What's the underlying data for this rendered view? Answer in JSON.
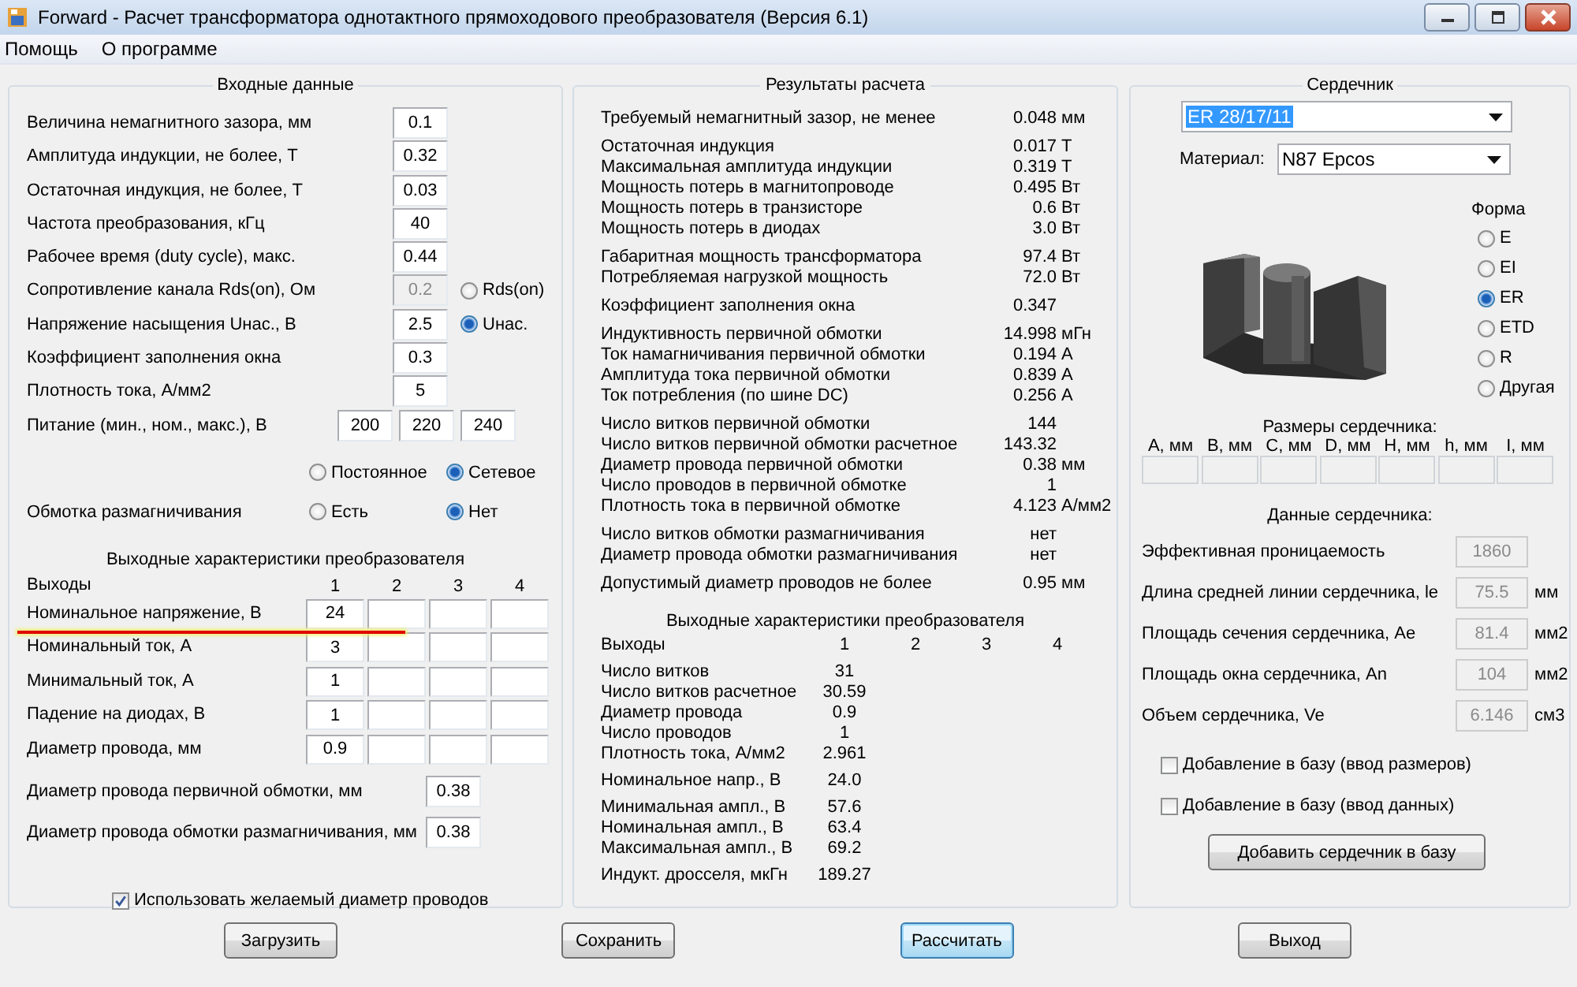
{
  "window": {
    "title": "Forward - Расчет трансформатора однотактного прямоходового преобразователя (Версия 6.1)"
  },
  "menu": [
    {
      "label": "Помощь"
    },
    {
      "label": "О программе"
    }
  ],
  "input_panel": {
    "title": "Входные данные",
    "fields": [
      {
        "label": "Величина немагнитного зазора, мм",
        "value": "0.1",
        "disabled": false
      },
      {
        "label": "Амплитуда индукции, не более, Т",
        "value": "0.32",
        "disabled": false
      },
      {
        "label": "Остаточная индукция, не более, Т",
        "value": "0.03",
        "disabled": false
      },
      {
        "label": "Частота преобразования, кГц",
        "value": "40",
        "disabled": false
      },
      {
        "label": "Рабочее время (duty cycle), макс.",
        "value": "0.44",
        "disabled": false
      },
      {
        "label": "Сопротивление канала Rds(on), Ом",
        "value": "0.2",
        "disabled": true,
        "radio": {
          "label": "Rds(on)",
          "selected": false
        }
      },
      {
        "label": "Напряжение насыщения Uнас., В",
        "value": "2.5",
        "disabled": false,
        "radio": {
          "label": "Uнас.",
          "selected": true
        }
      },
      {
        "label": "Коэффициент заполнения окна",
        "value": "0.3",
        "disabled": false
      },
      {
        "label": "Плотность тока, А/мм2",
        "value": "5",
        "disabled": false
      }
    ],
    "supply": {
      "label": "Питание (мин., ном., макс.), В",
      "values": [
        "200",
        "220",
        "240"
      ]
    },
    "source_options": [
      {
        "label": "Постоянное",
        "selected": false
      },
      {
        "label": "Сетевое",
        "selected": true
      }
    ],
    "demag": {
      "label": "Обмотка размагничивания",
      "options": [
        {
          "label": "Есть",
          "selected": false
        },
        {
          "label": "Нет",
          "selected": true
        }
      ]
    },
    "outputs": {
      "title": "Выходные характеристики преобразователя",
      "header": [
        "Выходы",
        "1",
        "2",
        "3",
        "4"
      ],
      "rows": [
        {
          "label": "Номинальное напряжение, В",
          "values": [
            "24"
          ]
        },
        {
          "label": "Номинальный ток, А",
          "values": [
            "3"
          ]
        },
        {
          "label": "Минимальный ток, А",
          "values": [
            "1"
          ]
        },
        {
          "label": "Падение на диодах, В",
          "values": [
            "1"
          ]
        },
        {
          "label": "Диаметр провода, мм",
          "values": [
            "0.9"
          ]
        }
      ]
    },
    "wire_fields": [
      {
        "label": "Диаметр провода первичной обмотки, мм",
        "value": "0.38"
      },
      {
        "label": "Диаметр провода обмотки размагничивания, мм",
        "value": "0.38"
      }
    ],
    "checkbox": {
      "label": "Использовать желаемый диаметр проводов",
      "checked": true
    }
  },
  "results_panel": {
    "title": "Результаты расчета",
    "groups": [
      [
        {
          "label": "Требуемый немагнитный зазор, не менее",
          "value": "0.048",
          "unit": "мм"
        }
      ],
      [
        {
          "label": "Остаточная индукция",
          "value": "0.017",
          "unit": "Т"
        },
        {
          "label": "Максимальная амплитуда индукции",
          "value": "0.319",
          "unit": "Т"
        },
        {
          "label": "Мощность потерь в магнитопроводе",
          "value": "0.495",
          "unit": "Вт"
        },
        {
          "label": "Мощность потерь в транзисторе",
          "value": "0.6",
          "unit": "Вт"
        },
        {
          "label": "Мощность потерь в диодах",
          "value": "3.0",
          "unit": "Вт"
        }
      ],
      [
        {
          "label": "Габаритная мощность трансформатора",
          "value": "97.4",
          "unit": "Вт"
        },
        {
          "label": "Потребляемая нагрузкой мощность",
          "value": "72.0",
          "unit": "Вт"
        }
      ],
      [
        {
          "label": "Коэффициент заполнения окна",
          "value": "0.347"
        }
      ],
      [
        {
          "label": "Индуктивность первичной обмотки",
          "value": "14.998",
          "unit": "мГн"
        },
        {
          "label": "Ток намагничивания первичной обмотки",
          "value": "0.194",
          "unit": "А"
        },
        {
          "label": "Амплитуда тока первичной обмотки",
          "value": "0.839",
          "unit": "А"
        },
        {
          "label": "Ток потребления (по шине DC)",
          "value": "0.256",
          "unit": "А"
        }
      ],
      [
        {
          "label": "Число витков первичной обмотки",
          "value": "144"
        },
        {
          "label": "Число витков первичной обмотки расчетное",
          "value": "143.32"
        },
        {
          "label": "Диаметр провода первичной обмотки",
          "value": "0.38",
          "unit": "мм"
        },
        {
          "label": "Число проводов в первичной обмотке",
          "value": "1"
        },
        {
          "label": "Плотность тока в первичной обмотке",
          "value": "4.123",
          "unit": "А/мм2"
        }
      ],
      [
        {
          "label": "Число витков обмотки размагничивания",
          "value": "нет"
        },
        {
          "label": "Диаметр провода обмотки размагничивания",
          "value": "нет"
        }
      ],
      [
        {
          "label": "Допустимый диаметр проводов не более",
          "value": "0.95",
          "unit": "мм"
        }
      ]
    ],
    "outputs": {
      "title": "Выходные характеристики преобразователя",
      "header": [
        "Выходы",
        "1",
        "2",
        "3",
        "4"
      ],
      "groups": [
        [
          {
            "label": "Число витков",
            "value": "31"
          },
          {
            "label": "Число витков расчетное",
            "value": "30.59"
          },
          {
            "label": "Диаметр провода",
            "value": "0.9"
          },
          {
            "label": "Число проводов",
            "value": "1"
          },
          {
            "label": "Плотность тока, А/мм2",
            "value": "2.961"
          }
        ],
        [
          {
            "label": "Номинальное напр., В",
            "value": "24.0"
          }
        ],
        [
          {
            "label": "Минимальная ампл., В",
            "value": "57.6"
          },
          {
            "label": "Номинальная ампл., В",
            "value": "63.4"
          },
          {
            "label": "Максимальная ампл., В",
            "value": "69.2"
          }
        ],
        [
          {
            "label": "Индукт. дросселя, мкГн",
            "value": "189.27"
          }
        ]
      ]
    }
  },
  "core_panel": {
    "title": "Сердечник",
    "core": {
      "value": "ER 28/17/11",
      "highlighted": true
    },
    "material": {
      "label": "Материал:",
      "value": "N87 Epcos"
    },
    "shape": {
      "title": "Форма",
      "options": [
        {
          "label": "E",
          "selected": false
        },
        {
          "label": "EI",
          "selected": false
        },
        {
          "label": "ER",
          "selected": true
        },
        {
          "label": "ETD",
          "selected": false
        },
        {
          "label": "R",
          "selected": false
        },
        {
          "label": "Другая",
          "selected": false
        }
      ]
    },
    "dimensions": {
      "title": "Размеры сердечника:",
      "columns": [
        "A, мм",
        "B, мм",
        "C, мм",
        "D, мм",
        "H, мм",
        "h, мм",
        "I, мм"
      ]
    },
    "data": {
      "title": "Данные сердечника:",
      "rows": [
        {
          "label": "Эффективная проницаемость",
          "value": "1860"
        },
        {
          "label": "Длина средней линии сердечника, le",
          "value": "75.5",
          "unit": "мм"
        },
        {
          "label": "Площадь сечения сердечника, Ae",
          "value": "81.4",
          "unit": "мм2"
        },
        {
          "label": "Площадь окна сердечника, An",
          "value": "104",
          "unit": "мм2"
        },
        {
          "label": "Объем сердечника, Ve",
          "value": "6.146",
          "unit": "см3"
        }
      ]
    },
    "checkboxes": [
      {
        "label": "Добавление в базу (ввод размеров)",
        "checked": false
      },
      {
        "label": "Добавление в базу (ввод данных)",
        "checked": false
      }
    ],
    "add_button": "Добавить сердечник в базу"
  },
  "buttons": [
    {
      "label": "Загрузить",
      "focused": false
    },
    {
      "label": "Сохранить",
      "focused": false
    },
    {
      "label": "Рассчитать",
      "focused": true
    },
    {
      "label": "Выход",
      "focused": false
    }
  ]
}
